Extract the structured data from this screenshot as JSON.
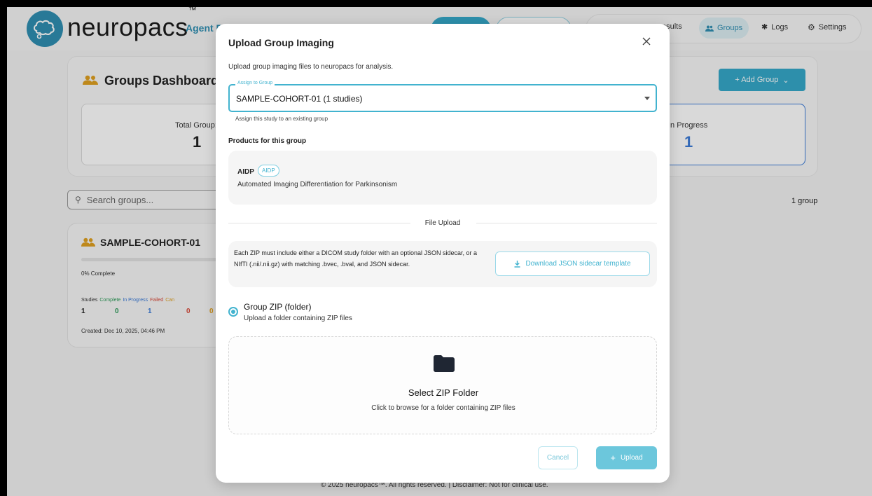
{
  "header": {
    "brand": "neuropacs",
    "brand_tm": "™",
    "agent_label": "Agent P",
    "nav": {
      "results": "esults",
      "groups": "Groups",
      "logs": "Logs",
      "settings": "Settings"
    }
  },
  "dashboard": {
    "title": "Groups Dashboard",
    "add_group": "+ Add Group",
    "stats": [
      {
        "label": "Total Group:",
        "value": "1"
      },
      {
        "label": "In Progress",
        "value": "1"
      }
    ],
    "search_placeholder": "Search groups...",
    "group_count": "1 group"
  },
  "group_card": {
    "name": "SAMPLE-COHORT-01",
    "progress_pct": 0,
    "progress_text": "0% Complete",
    "columns": [
      "Studies",
      "Complete",
      "In Progress",
      "Failed",
      "Can"
    ],
    "values": [
      "1",
      "0",
      "1",
      "0",
      "0"
    ],
    "created": "Created: Dec 10, 2025, 04:46 PM"
  },
  "footer": "© 2025 neuropacs™. All rights reserved. | Disclaimer: Not for clinical use.",
  "modal": {
    "title": "Upload Group Imaging",
    "description": "Upload group imaging files to neuropacs for analysis.",
    "assign_label": "Assign to Group",
    "assign_value": "SAMPLE-COHORT-01 (1 studies)",
    "assign_help": "Assign this study to an existing group",
    "products_heading": "Products for this group",
    "product": {
      "name": "AIDP",
      "badge": "AIDP",
      "description": "Automated Imaging Differentiation for Parkinsonism"
    },
    "file_upload_label": "File Upload",
    "info_text": "Each ZIP must include either a DICOM study folder with an optional JSON sidecar, or a NIfTI (.nii/.nii.gz) with matching .bvec, .bval, and JSON sidecar.",
    "download_button": "Download JSON sidecar template",
    "radio_title": "Group ZIP (folder)",
    "radio_sub": "Upload a folder containing ZIP files",
    "dropzone_title": "Select ZIP Folder",
    "dropzone_sub": "Click to browse for a folder containing ZIP files",
    "cancel": "Cancel",
    "upload": "Upload"
  },
  "colors": {
    "accent": "#42b3cf",
    "brand_blue": "#2f8fb2",
    "complete": "#2e9c5a",
    "in_progress": "#3b7bd8",
    "failed": "#d94a3a",
    "canceled": "#e0a020"
  }
}
